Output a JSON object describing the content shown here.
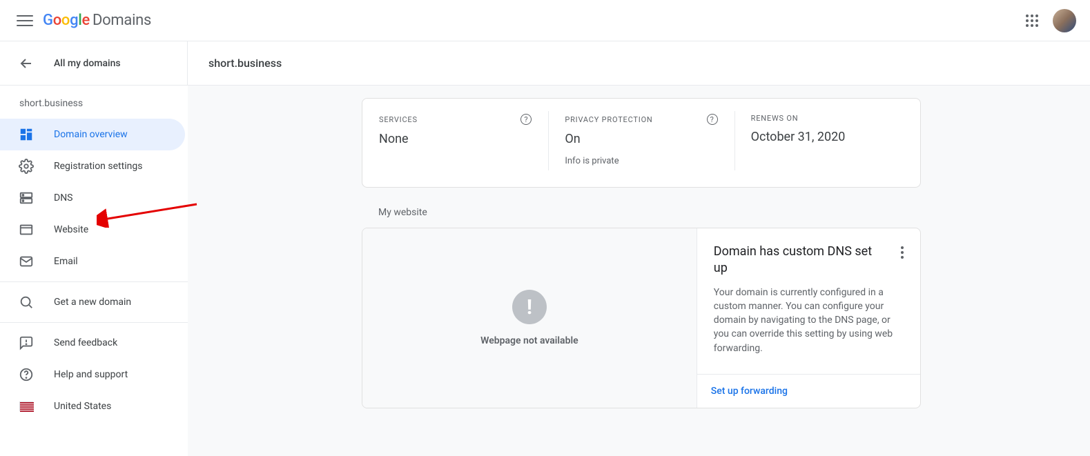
{
  "topbar": {
    "logo_word": "Domains"
  },
  "header": {
    "back_label": "All my domains",
    "page_title": "short.business"
  },
  "sidebar": {
    "domain": "short.business",
    "items": [
      {
        "label": "Domain overview"
      },
      {
        "label": "Registration settings"
      },
      {
        "label": "DNS"
      },
      {
        "label": "Website"
      },
      {
        "label": "Email"
      },
      {
        "label": "Get a new domain"
      },
      {
        "label": "Send feedback"
      },
      {
        "label": "Help and support"
      },
      {
        "label": "United States"
      }
    ]
  },
  "stats": {
    "services": {
      "label": "Services",
      "value": "None"
    },
    "privacy": {
      "label": "Privacy Protection",
      "value": "On",
      "sub": "Info is private"
    },
    "renews": {
      "label": "Renews on",
      "value": "October 31, 2020"
    }
  },
  "website": {
    "section_title": "My website",
    "preview_unavailable": "Webpage not available",
    "info_title": "Domain has custom DNS set up",
    "info_desc": "Your domain is currently configured in a custom manner. You can configure your domain by navigating to the DNS page, or you can override this setting by using web forwarding.",
    "forward_link": "Set up forwarding"
  }
}
